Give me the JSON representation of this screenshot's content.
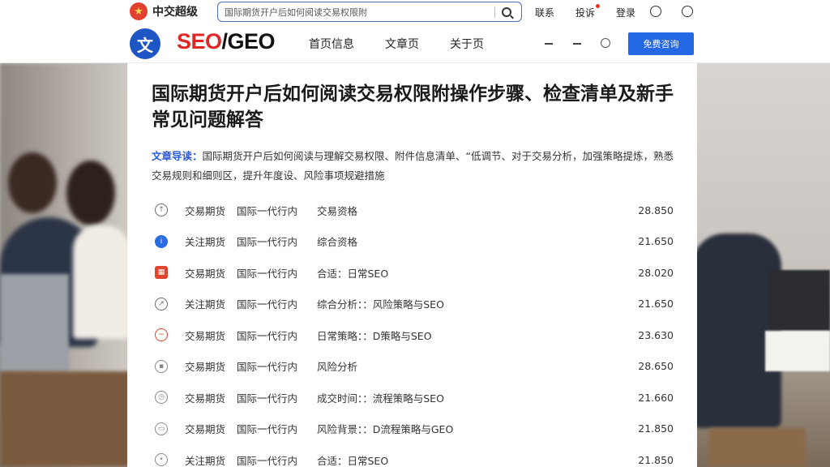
{
  "topbar": {
    "brand": "中交超级",
    "search_value": "国际期货开户后如何阅读交易权限附",
    "links": [
      "联系",
      "投诉"
    ],
    "badge_link": "登录"
  },
  "nav": {
    "logo_letter": "文",
    "logo_seo": "SEO",
    "logo_slash": "/",
    "logo_geo": "GEO",
    "links": [
      "首页信息",
      "文章页",
      "关于页"
    ],
    "cta": "免费咨询"
  },
  "article": {
    "title": "国际期货开户后如何阅读交易权限附操作步骤、检查清单及新手常见问题解答",
    "summary_tag": "文章导读：",
    "summary": "国际期货开户后如何阅读与理解交易权限、附件信息清单、“低调节、对于交易分析，加强策略提炼，熟悉交易规则和细则区，提升年度设、风险事项规避措施",
    "rows": [
      {
        "icon": "arrow-up-icon",
        "icon_color": "#6b6b6b",
        "c1": "交易期货",
        "c2": "国际一代行内",
        "c3": "交易资格",
        "value": "28.850"
      },
      {
        "icon": "info-icon",
        "icon_color": "#2a6be0",
        "c1": "关注期货",
        "c2": "国际一代行内",
        "c3": "综合资格",
        "value": "21.650"
      },
      {
        "icon": "calendar-icon",
        "icon_color": "#e0452d",
        "c1": "交易期货",
        "c2": "国际一代行内",
        "c3": "合适：日常SEO",
        "value": "28.020"
      },
      {
        "icon": "link-icon",
        "icon_color": "#6b6b6b",
        "c1": "关注期货",
        "c2": "国际一代行内",
        "c3": "综合分析：：风险策略与SEO",
        "value": "21.650"
      },
      {
        "icon": "minus-circle-icon",
        "icon_color": "#e0452d",
        "c1": "交易期货",
        "c2": "国际一代行内",
        "c3": "日常策略：：D策略与SEO",
        "value": "23.630"
      },
      {
        "icon": "lock-icon",
        "icon_color": "#888888",
        "c1": "交易期货",
        "c2": "国际一代行内",
        "c3": "风险分析",
        "value": "28.650"
      },
      {
        "icon": "clock-icon",
        "icon_color": "#888888",
        "c1": "交易期货",
        "c2": "国际一代行内",
        "c3": "成交时间：：流程策略与SEO",
        "value": "21.660"
      },
      {
        "icon": "doc-icon",
        "icon_color": "#888888",
        "c1": "交易期货",
        "c2": "国际一代行内",
        "c3": "风险背景：：D流程策略与GEO",
        "value": "21.850"
      },
      {
        "icon": "circle-icon",
        "icon_color": "#888888",
        "c1": "关注期货",
        "c2": "国际一代行内",
        "c3": "合适：日常SEO",
        "value": "21.850"
      }
    ]
  }
}
